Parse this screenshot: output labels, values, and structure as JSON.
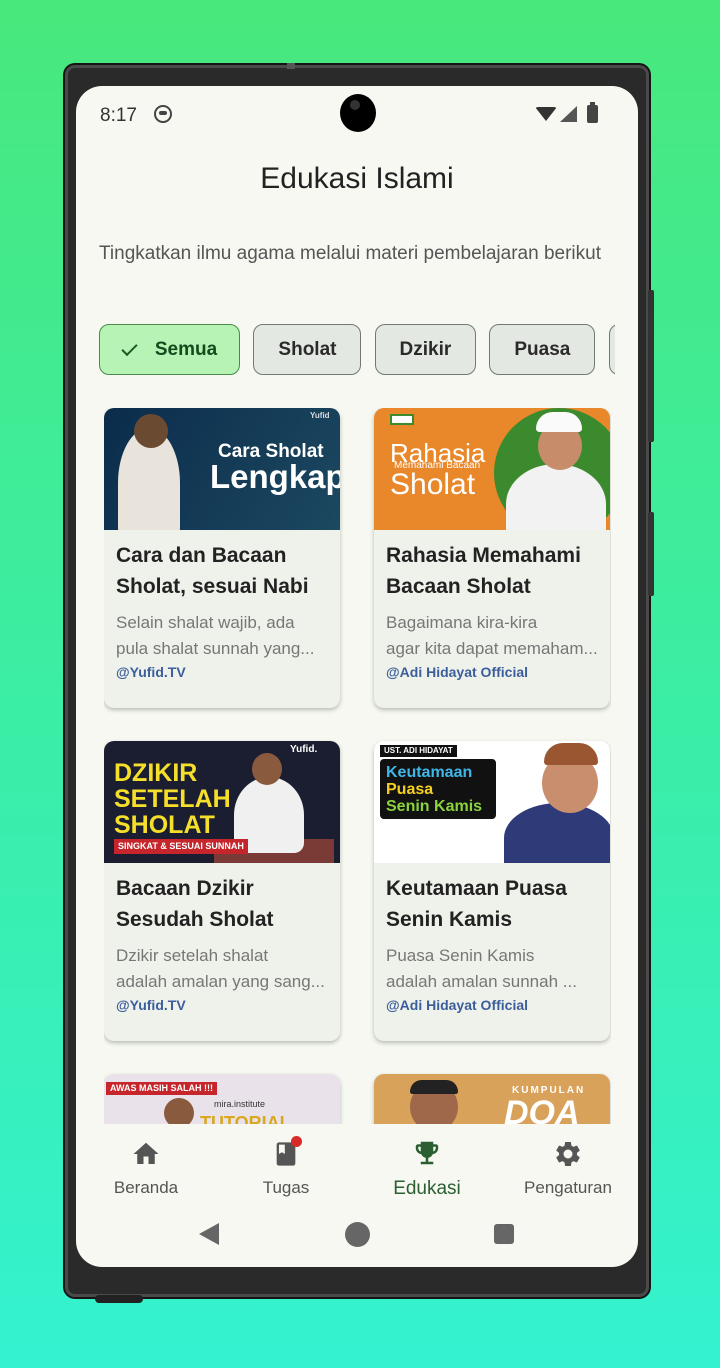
{
  "status_bar": {
    "time": "8:17"
  },
  "page": {
    "title": "Edukasi Islami",
    "subtitle": "Tingkatkan ilmu agama melalui materi pembelajaran berikut"
  },
  "filters": [
    {
      "label": "Semua",
      "selected": true
    },
    {
      "label": "Sholat",
      "selected": false
    },
    {
      "label": "Dzikir",
      "selected": false
    },
    {
      "label": "Puasa",
      "selected": false
    }
  ],
  "videos": [
    {
      "title": "Cara dan Bacaan Sholat, sesuai Nabi",
      "desc_line1": "Selain shalat wajib, ada",
      "desc_line2": "pula shalat sunnah yang...",
      "channel": "@Yufid.TV",
      "thumb": {
        "line1": "Cara Sholat",
        "line2": "Lengkap",
        "badge": "Yufid"
      }
    },
    {
      "title": "Rahasia Memahami Bacaan Sholat",
      "desc_line1": "Bagaimana kira-kira",
      "desc_line2": "agar kita dapat memaham...",
      "channel": "@Adi Hidayat Official",
      "thumb": {
        "line1": "Rahasia",
        "line2": "Memahami Bacaan",
        "line3": "Sholat"
      }
    },
    {
      "title": "Bacaan Dzikir Sesudah Sholat",
      "desc_line1": "Dzikir setelah shalat",
      "desc_line2": "adalah amalan yang sang...",
      "channel": "@Yufid.TV",
      "thumb": {
        "line1": "DZIKIR",
        "line2": "SETELAH",
        "line3": "SHOLAT",
        "tag": "SINGKAT & SESUAI SUNNAH",
        "badge": "Yufid."
      }
    },
    {
      "title": "Keutamaan Puasa Senin Kamis",
      "desc_line1": "Puasa Senin Kamis",
      "desc_line2": "adalah amalan sunnah ...",
      "channel": "@Adi Hidayat Official",
      "thumb": {
        "tag": "UST. ADI HIDAYAT",
        "line1": "Keutamaan",
        "line2": "Puasa",
        "line3": "Senin Kamis"
      }
    },
    {
      "title": "",
      "channel": "",
      "thumb": {
        "tag": "AWAS MASIH SALAH !!!",
        "line1": "mira.institute",
        "line2": "TUTORIAL"
      }
    },
    {
      "title": "",
      "channel": "",
      "thumb": {
        "line1": "KUMPULAN",
        "line2": "DOA"
      }
    }
  ],
  "bottom_nav": [
    {
      "label": "Beranda",
      "icon": "home-icon",
      "active": false
    },
    {
      "label": "Tugas",
      "icon": "book-icon",
      "active": false,
      "badge": true
    },
    {
      "label": "Edukasi",
      "icon": "trophy-icon",
      "active": true
    },
    {
      "label": "Pengaturan",
      "icon": "gear-icon",
      "active": false
    }
  ],
  "colors": {
    "accent": "#2b5f32",
    "chip_selected": "#b7f3b5",
    "channel": "#3c5d9c",
    "badge": "#d92a2a"
  }
}
